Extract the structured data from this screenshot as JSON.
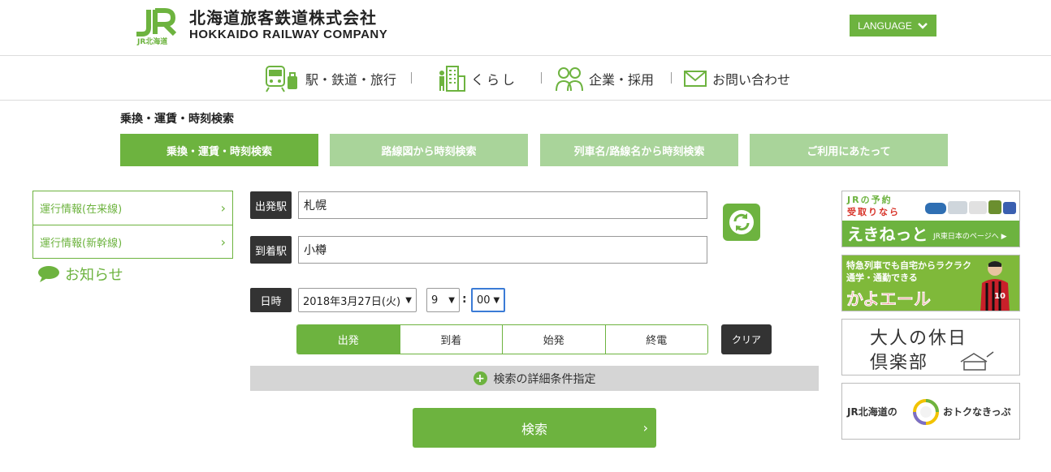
{
  "header": {
    "logo_mark": "JR",
    "logo_sub": "JR北海道",
    "company_ja": "北海道旅客鉄道株式会社",
    "company_en": "HOKKAIDO RAILWAY COMPANY",
    "language_label": "LANGUAGE"
  },
  "nav": {
    "items": [
      {
        "label": "駅・鉄道・旅行",
        "icon": "train-icon"
      },
      {
        "label": "くらし",
        "icon": "building-icon"
      },
      {
        "label": "企業・採用",
        "icon": "people-icon"
      },
      {
        "label": "お問い合わせ",
        "icon": "mail-icon"
      }
    ],
    "separator": "|"
  },
  "page_title": "乗換・運賃・時刻検索",
  "tabs": [
    {
      "label": "乗換・運賃・時刻検索",
      "active": true
    },
    {
      "label": "路線図から時刻検索",
      "active": false
    },
    {
      "label": "列車名/路線名から時刻検索",
      "active": false
    },
    {
      "label": "ご利用にあたって",
      "active": false
    }
  ],
  "sidebar": {
    "items": [
      {
        "label": "運行情報(在来線)"
      },
      {
        "label": "運行情報(新幹線)"
      }
    ],
    "news_label": "お知らせ"
  },
  "form": {
    "from_label": "出発駅",
    "from_value": "札幌",
    "to_label": "到着駅",
    "to_value": "小樽",
    "datetime_label": "日時",
    "date_value": "2018年3月27日(火)",
    "hour_value": "9",
    "minute_value": "00",
    "time_separator": ":",
    "mode_options": [
      {
        "label": "出発",
        "selected": true
      },
      {
        "label": "到着",
        "selected": false
      },
      {
        "label": "始発",
        "selected": false
      },
      {
        "label": "終電",
        "selected": false
      }
    ],
    "clear_label": "クリア",
    "detail_label": "検索の詳細条件指定",
    "search_label": "検索"
  },
  "banners": {
    "ekinet": {
      "line1": "JRの予約",
      "line2": "受取りなら",
      "brand": "えきねっと",
      "link": "JR東日本のページへ ▶"
    },
    "kayoeru": {
      "line1": "特急列車でも自宅からラクラク",
      "line2": "通学・通勤できる",
      "brand": "かよエール",
      "jersey_number": "10"
    },
    "otona": {
      "line1": "大人の休日",
      "line2": "倶楽部"
    },
    "otoku": {
      "left": "JR北海道の",
      "right": "おトクなきっぷ"
    }
  },
  "colors": {
    "brand_green": "#6db33f",
    "tab_inactive": "#a9d49a",
    "dark_label": "#333333",
    "detail_bar": "#d5d5d5"
  }
}
